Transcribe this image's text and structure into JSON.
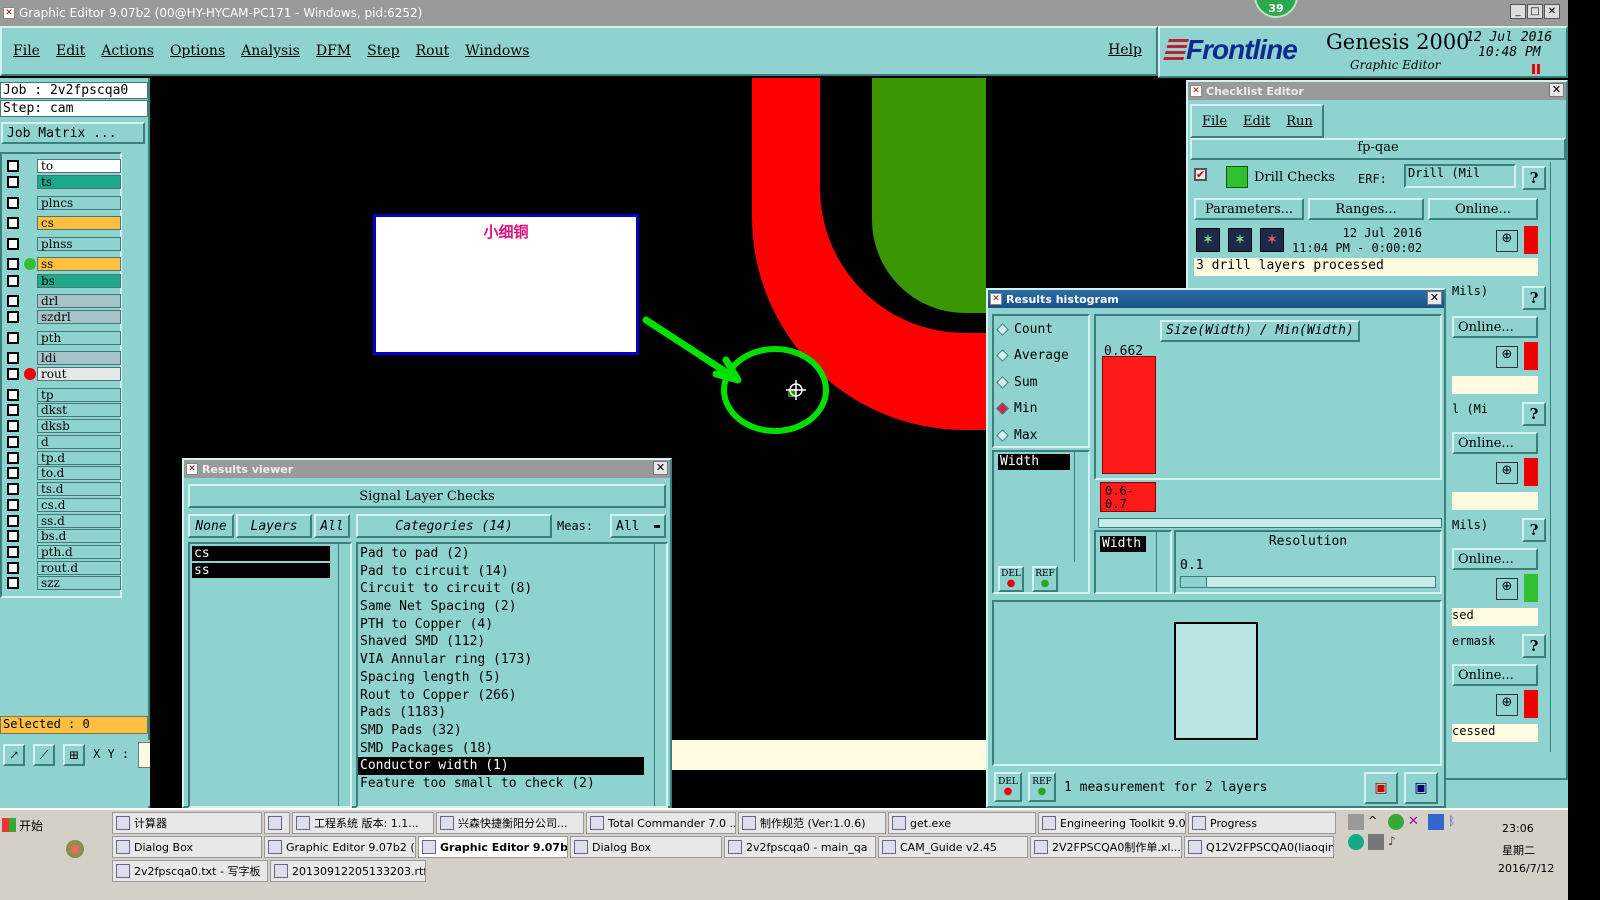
{
  "window": {
    "title": "Graphic Editor 9.07b2 (00@HY-HYCAM-PC171 - Windows, pid:6252)",
    "badge": "39"
  },
  "menu": [
    "File",
    "Edit",
    "Actions",
    "Options",
    "Analysis",
    "DFM",
    "Step",
    "Rout",
    "Windows"
  ],
  "help_label": "Help",
  "brand": {
    "logo": "Frontline",
    "product": "Genesis 2000",
    "sub": "Graphic Editor",
    "date": "12 Jul 2016",
    "time": "10:48 PM"
  },
  "job": {
    "job_line": "Job : 2v2fpscqa0",
    "step_line": "Step: cam",
    "matrix_button": "Job Matrix ..."
  },
  "layers": [
    {
      "name": "to",
      "color": "#ffffff"
    },
    {
      "name": "ts",
      "color": "#1fa88a"
    },
    {
      "name": "plncs",
      "color": "#8fd3d0"
    },
    {
      "name": "cs",
      "color": "#ffc040"
    },
    {
      "name": "plnss",
      "color": "#8fd3d0"
    },
    {
      "name": "ss",
      "color": "#ffc040"
    },
    {
      "name": "bs",
      "color": "#1fa88a"
    },
    {
      "name": "drl",
      "color": "#a6c3c8"
    },
    {
      "name": "szdrl",
      "color": "#a6c3c8"
    },
    {
      "name": "pth",
      "color": "#8fd3d0"
    },
    {
      "name": "ldi",
      "color": "#a6c3c8"
    },
    {
      "name": "rout",
      "color": "#e4e8e8"
    },
    {
      "name": "tp",
      "color": "#8fd3d0"
    },
    {
      "name": "dkst",
      "color": "#8fd3d0"
    },
    {
      "name": "dksb",
      "color": "#8fd3d0"
    },
    {
      "name": "d",
      "color": "#8fd3d0"
    },
    {
      "name": "tp.d",
      "color": "#8fd3d0"
    },
    {
      "name": "to.d",
      "color": "#8fd3d0"
    },
    {
      "name": "ts.d",
      "color": "#8fd3d0"
    },
    {
      "name": "cs.d",
      "color": "#8fd3d0"
    },
    {
      "name": "ss.d",
      "color": "#8fd3d0"
    },
    {
      "name": "bs.d",
      "color": "#8fd3d0"
    },
    {
      "name": "pth.d",
      "color": "#8fd3d0"
    },
    {
      "name": "rout.d",
      "color": "#8fd3d0"
    },
    {
      "name": "szz",
      "color": "#8fd3d0"
    }
  ],
  "selected_label": "Selected : 0",
  "xy_label": "X Y :",
  "annotation": "小细铜",
  "checklist": {
    "title": "Checklist Editor",
    "menu": [
      "File",
      "Edit",
      "Run"
    ],
    "name": "fp-qae",
    "drill_checks": "Drill Checks",
    "erf_label": "ERF:",
    "erf_value": "Drill (Mil",
    "parameters": "Parameters...",
    "ranges": "Ranges...",
    "online": "Online...",
    "run_time": "12 Jul 2016\n11:04 PM - 0:00:02",
    "status": "3 drill layers processed",
    "peek": {
      "mils1": "Mils)",
      "mi": "l (Mi",
      "mils2": "Mils)",
      "sed": "sed",
      "rmask": "ermask",
      "cessed": "cessed"
    }
  },
  "histogram": {
    "title": "Results histogram",
    "options": [
      "Count",
      "Average",
      "Sum",
      "Min",
      "Max"
    ],
    "selected_option": "Min",
    "list_item": "Width",
    "chart_title": "Size(Width) / Min(Width)",
    "bar_value": "0.662",
    "bar_label": "0.6-\n0.7",
    "res_list_item": "Width",
    "resolution_label": "Resolution",
    "resolution_value": "0.1",
    "del": "DEL",
    "ref": "REF",
    "status": "1 measurement for 2 layers"
  },
  "results": {
    "title": "Results viewer",
    "header": "Signal Layer Checks",
    "none_btn": "None",
    "layers_btn": "Layers",
    "all_btn": "All",
    "categories_btn": "Categories (14)",
    "meas_label": "Meas:",
    "meas_value": "All",
    "layers": [
      "cs",
      "ss"
    ],
    "categories": [
      "Pad to pad (2)",
      "Pad to circuit (14)",
      "Circuit to circuit (8)",
      "Same Net Spacing (2)",
      "PTH to Copper (4)",
      "Shaved SMD (112)",
      "VIA Annular ring (173)",
      "Spacing length (5)",
      "Rout to Copper (266)",
      "Pads (1183)",
      "SMD Pads (32)",
      "SMD Packages (18)",
      "Conductor width (1)",
      "Feature too small to check (2)"
    ],
    "selected_category": "Conductor width (1)"
  },
  "taskbar": {
    "start": "开始",
    "row1": [
      "计算器",
      "",
      "工程系统  版本: 1.1...",
      "兴森快捷衡阳分公司...",
      "Total Commander 7.0 ...",
      "制作规范 (Ver:1.0.6)",
      "get.exe",
      "Engineering Toolkit 9.0...",
      "Progress"
    ],
    "row2": [
      "Dialog Box",
      "Graphic Editor 9.07b2 (...",
      "Graphic Editor 9.07b...",
      "Dialog Box",
      "2v2fpscqa0 - main_qa",
      "CAM_Guide v2.45",
      "2V2FPSCQA0制作单.xl...",
      "Q12V2FPSCQA0(liaoqin..."
    ],
    "row3": [
      "2v2fpscqa0.txt - 写字板",
      "20130912205133203.rtf..."
    ],
    "clock_time": "23:06",
    "clock_day": "星期二",
    "clock_date": "2016/7/12"
  }
}
